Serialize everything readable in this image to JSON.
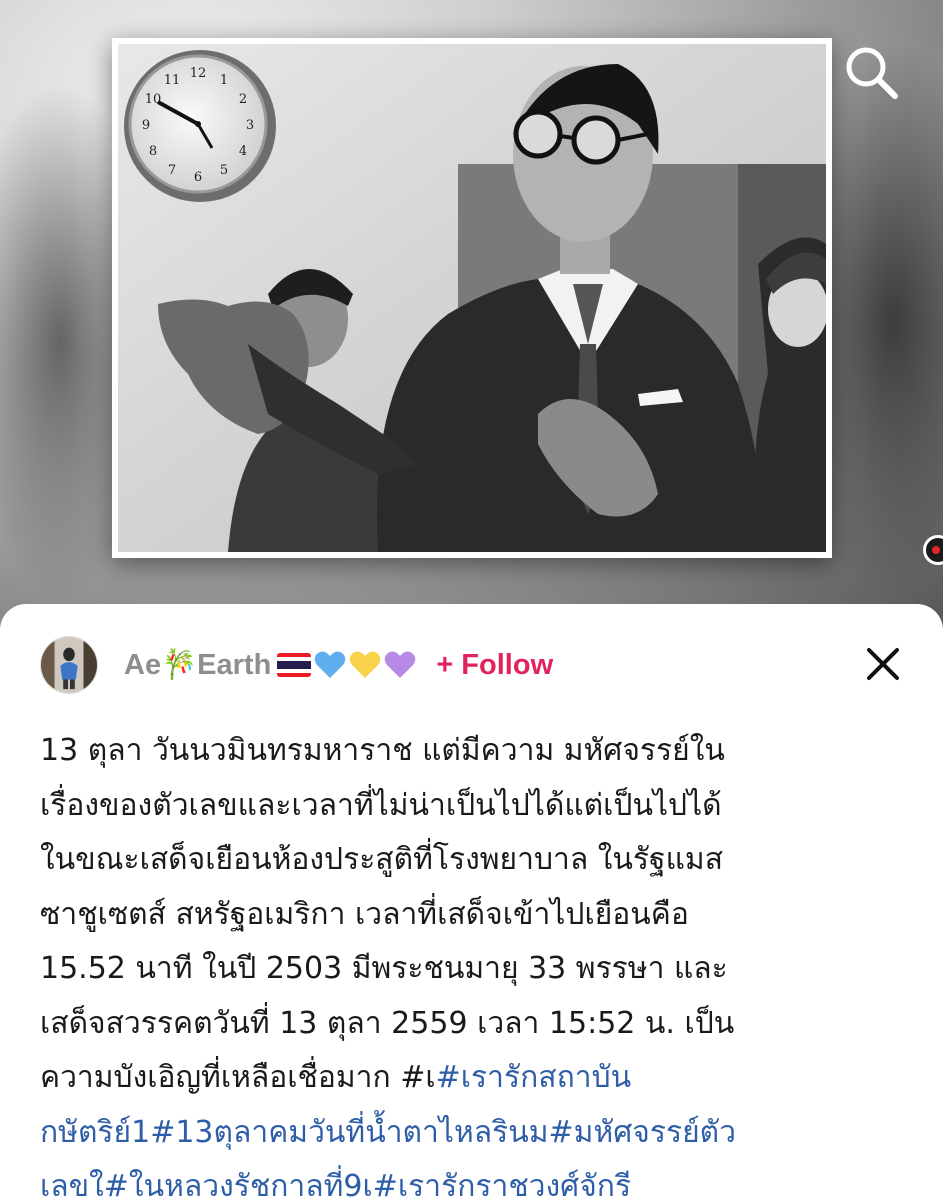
{
  "search": {
    "icon": "search-icon"
  },
  "post": {
    "author": {
      "name": "Ae🎋Earth",
      "emoji": [
        "flag-thailand",
        "blue-heart",
        "yellow-heart",
        "purple-heart"
      ]
    },
    "follow_label": "+ Follow",
    "close_icon": "close-icon",
    "caption_lines": [
      {
        "parts": [
          {
            "text": "13 ตุลา วันนวมินทรมหาราช  แต่มีความ มหัศจรรย์ใน",
            "tag": false
          }
        ]
      },
      {
        "parts": [
          {
            "text": "เรื่องของตัวเลขและเวลาที่ไม่น่าเป็นไปได้แต่เป็นไปได้",
            "tag": false
          }
        ]
      },
      {
        "parts": [
          {
            "text": "ในขณะเสด็จเยือนห้องประสูติที่โรงพยาบาล ในรัฐแมส",
            "tag": false
          }
        ]
      },
      {
        "parts": [
          {
            "text": "ซาชูเซตส์ สหรัฐอเมริกา เวลาที่เสด็จเข้าไปเยือนคือ",
            "tag": false
          }
        ]
      },
      {
        "parts": [
          {
            "text": "15.52 นาที ในปี 2503 มีพระชนมายุ 33 พรรษา และ",
            "tag": false
          }
        ]
      },
      {
        "parts": [
          {
            "text": "เสด็จสวรรคตวันที่ 13 ตุลา 2559 เวลา 15:52 น. เป็น",
            "tag": false
          }
        ]
      },
      {
        "parts": [
          {
            "text": "ความบังเอิญที่เหลือเชื่อมาก  #เ",
            "tag": false
          },
          {
            "text": "#เรารักสถาบัน",
            "tag": true
          }
        ]
      },
      {
        "parts": [
          {
            "text": "กษัตริย์1",
            "tag": true
          },
          {
            "text": "#13ตุลาคมวันที่น้ำตาไหลรินม",
            "tag": true
          },
          {
            "text": "#มหัศจรรย์ตัว",
            "tag": true
          }
        ]
      },
      {
        "parts": [
          {
            "text": "เลขใ",
            "tag": true
          },
          {
            "text": "#ในหลวงรัชกาลที่9เ",
            "tag": true
          },
          {
            "text": "#เรารักราชวงศ์จักรี",
            "tag": true
          }
        ]
      }
    ]
  },
  "photo": {
    "clock_numerals": [
      "12",
      "1",
      "2",
      "3",
      "4",
      "5",
      "6",
      "7",
      "8",
      "9",
      "10",
      "11"
    ]
  },
  "colors": {
    "follow": "#e0245e",
    "hashtag": "#2f5ea8",
    "author": "#8e8e8e",
    "text": "#1a1a1a"
  }
}
